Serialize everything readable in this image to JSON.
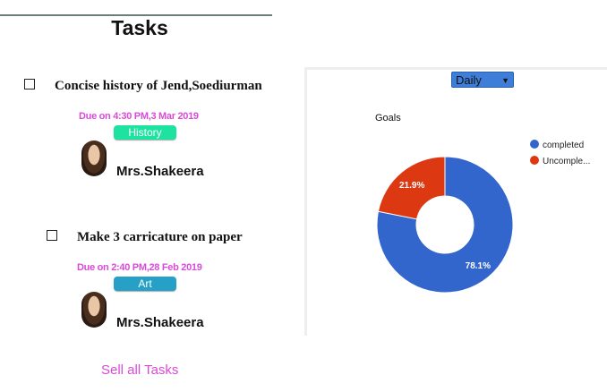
{
  "header": {
    "title": "Tasks"
  },
  "tasks": [
    {
      "title": "Concise history of Jend,Soediurman",
      "due": "Due on 4:30 PM,3 Mar 2019",
      "tag": "History",
      "tag_color": "#1ee3a0",
      "assignee": "Mrs.Shakeera"
    },
    {
      "title": "Make 3 carricature on paper",
      "due": "Due on 2:40 PM,28 Feb 2019",
      "tag": "Art",
      "tag_color": "#26a0c6",
      "assignee": "Mrs.Shakeera"
    }
  ],
  "footer": {
    "sell_all_label": "Sell all Tasks"
  },
  "goals_panel": {
    "period_selected": "Daily",
    "period_select_color": "#3f7ed8"
  },
  "chart_data": {
    "type": "pie",
    "title": "Goals",
    "donut": true,
    "legend_position": "right",
    "series": [
      {
        "name": "completed",
        "value": 78.1,
        "label": "78.1%",
        "color": "#3366cc"
      },
      {
        "name": "Uncomple...",
        "value": 21.9,
        "label": "21.9%",
        "color": "#dc3912"
      }
    ]
  }
}
